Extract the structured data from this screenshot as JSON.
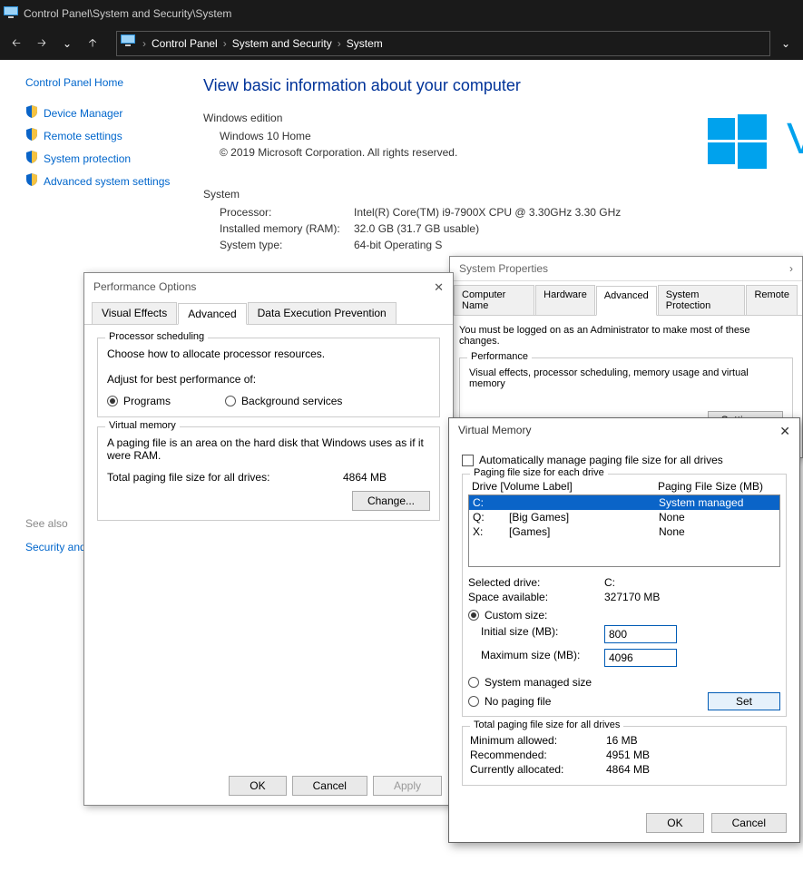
{
  "titlebar": {
    "path": "Control Panel\\System and Security\\System"
  },
  "breadcrumb": {
    "seg1": "Control Panel",
    "seg2": "System and Security",
    "seg3": "System"
  },
  "sidebar": {
    "home": "Control Panel Home",
    "links": [
      {
        "label": "Device Manager"
      },
      {
        "label": "Remote settings"
      },
      {
        "label": "System protection"
      },
      {
        "label": "Advanced system settings"
      }
    ]
  },
  "main": {
    "heading": "View basic information about your computer",
    "edition_title": "Windows edition",
    "edition_name": "Windows 10 Home",
    "copyright": "© 2019 Microsoft Corporation. All rights reserved.",
    "brand_char": "V",
    "system_title": "System",
    "processor_label": "Processor:",
    "processor_value": "Intel(R) Core(TM) i9-7900X CPU @ 3.30GHz   3.30 GHz",
    "ram_label": "Installed memory (RAM):",
    "ram_value": "32.0 GB (31.7 GB usable)",
    "type_label": "System type:",
    "type_value": "64-bit Operating S"
  },
  "seealso": {
    "title": "See also",
    "link": "Security and"
  },
  "sysprop": {
    "title": "System Properties",
    "tabs": [
      "Computer Name",
      "Hardware",
      "Advanced",
      "System Protection",
      "Remote"
    ],
    "active_tab": "Advanced",
    "note": "You must be logged on as an Administrator to make most of these changes.",
    "perf_legend": "Performance",
    "perf_desc": "Visual effects, processor scheduling, memory usage and virtual memory",
    "settings_btn": "Settings..."
  },
  "perfopt": {
    "title": "Performance Options",
    "tabs": [
      "Visual Effects",
      "Advanced",
      "Data Execution Prevention"
    ],
    "active_tab": "Advanced",
    "sched_legend": "Processor scheduling",
    "sched_desc": "Choose how to allocate processor resources.",
    "adjust_label": "Adjust for best performance of:",
    "radio_programs": "Programs",
    "radio_bg": "Background services",
    "vm_legend": "Virtual memory",
    "vm_desc": "A paging file is an area on the hard disk that Windows uses as if it were RAM.",
    "vm_total_label": "Total paging file size for all drives:",
    "vm_total_value": "4864 MB",
    "change_btn": "Change...",
    "ok": "OK",
    "cancel": "Cancel",
    "apply": "Apply"
  },
  "vmem": {
    "title": "Virtual Memory",
    "auto_label": "Automatically manage paging file size for all drives",
    "drive_legend": "Paging file size for each drive",
    "col_drive": "Drive  [Volume Label]",
    "col_size": "Paging File Size (MB)",
    "drives": [
      {
        "letter": "C:",
        "label": "",
        "size": "System managed",
        "selected": true
      },
      {
        "letter": "Q:",
        "label": "[Big Games]",
        "size": "None",
        "selected": false
      },
      {
        "letter": "X:",
        "label": "[Games]",
        "size": "None",
        "selected": false
      }
    ],
    "selected_label": "Selected drive:",
    "selected_value": "C:",
    "space_label": "Space available:",
    "space_value": "327170 MB",
    "custom_label": "Custom size:",
    "initial_label": "Initial size (MB):",
    "initial_value": "800",
    "max_label": "Maximum size (MB):",
    "max_value": "4096",
    "sys_managed": "System managed size",
    "no_paging": "No paging file",
    "set_btn": "Set",
    "totals_legend": "Total paging file size for all drives",
    "min_label": "Minimum allowed:",
    "min_value": "16 MB",
    "rec_label": "Recommended:",
    "rec_value": "4951 MB",
    "cur_label": "Currently allocated:",
    "cur_value": "4864 MB",
    "ok": "OK",
    "cancel": "Cancel"
  }
}
